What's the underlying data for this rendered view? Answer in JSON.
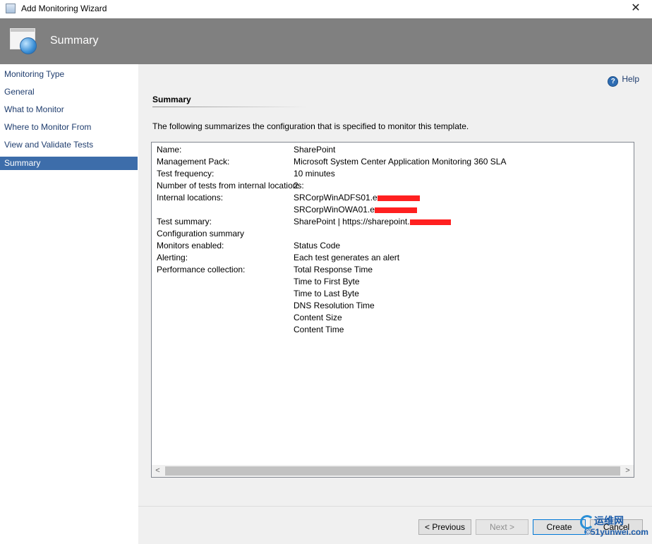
{
  "window": {
    "title": "Add Monitoring Wizard",
    "close_glyph": "✕"
  },
  "banner": {
    "heading": "Summary"
  },
  "nav": {
    "items": [
      {
        "label": "Monitoring Type"
      },
      {
        "label": "General"
      },
      {
        "label": "What to Monitor"
      },
      {
        "label": "Where to Monitor From"
      },
      {
        "label": "View and Validate Tests"
      },
      {
        "label": "Summary"
      }
    ],
    "active_index": 5
  },
  "content": {
    "help_label": "Help",
    "section_title": "Summary",
    "intro": "The following summarizes the configuration that is specified to monitor this template."
  },
  "summary_rows": [
    {
      "key": "Name:",
      "value": "SharePoint"
    },
    {
      "key": "Management Pack:",
      "value": "Microsoft System Center Application Monitoring 360 SLA"
    },
    {
      "key": "Test frequency:",
      "value": "10 minutes"
    },
    {
      "key": "Number of tests from internal locations:",
      "value": "2"
    },
    {
      "key": "Internal locations:",
      "value": "SRCorpWinADFS01.e"
    },
    {
      "key": "",
      "value": "SRCorpWinOWA01.e"
    },
    {
      "key": "Test summary:",
      "value": "SharePoint | https://sharepoint."
    },
    {
      "key": "Configuration summary",
      "value": ""
    },
    {
      "key": "Monitors enabled:",
      "value": "Status Code"
    },
    {
      "key": "Alerting:",
      "value": "Each test generates an alert"
    },
    {
      "key": "Performance collection:",
      "value": "Total Response Time"
    },
    {
      "key": "",
      "value": "Time to First Byte"
    },
    {
      "key": "",
      "value": "Time to Last Byte"
    },
    {
      "key": "",
      "value": "DNS Resolution Time"
    },
    {
      "key": "",
      "value": "Content Size"
    },
    {
      "key": "",
      "value": "Content Time"
    }
  ],
  "scrollbar": {
    "left_arrow": "<",
    "right_arrow": ">"
  },
  "buttons": {
    "previous": "< Previous",
    "next": "Next >",
    "create": "Create",
    "cancel": "Cancel"
  },
  "watermark": {
    "line1": "运维网",
    "line2": "©51yunwei.com"
  },
  "colors": {
    "banner": "#808080",
    "nav_active": "#3d6daa",
    "nav_text": "#1f3d6e",
    "redaction": "#ff2020"
  }
}
